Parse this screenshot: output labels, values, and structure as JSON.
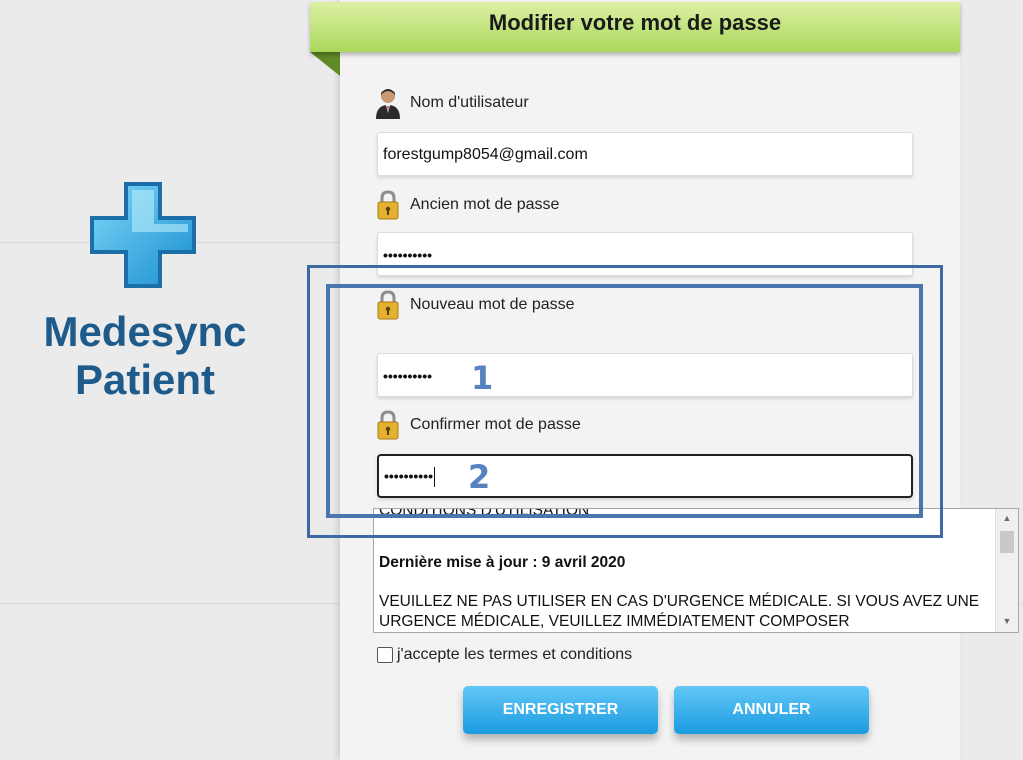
{
  "brand": {
    "line1": "Medesync",
    "line2": "Patient"
  },
  "header": {
    "title": "Modifier votre mot de passe"
  },
  "form": {
    "username_label": "Nom d'utilisateur",
    "username_value": "forestgump8054@gmail.com",
    "old_password_label": "Ancien mot de passe",
    "old_password_value": "••••••••••",
    "new_password_label": "Nouveau mot de passe",
    "new_password_value": "••••••••••",
    "confirm_password_label": "Confirmer mot de passe",
    "confirm_password_value": "••••••••••"
  },
  "annotations": {
    "step1": "1",
    "step2": "2"
  },
  "terms": {
    "heading": "CONDITIONS D'UTILISATION",
    "updated": "Dernière mise à jour : 9 avril 2020",
    "paragraph": "VEUILLEZ NE PAS UTILISER EN CAS D'URGENCE MÉDICALE. SI VOUS AVEZ UNE URGENCE MÉDICALE, VEUILLEZ IMMÉDIATEMENT COMPOSER"
  },
  "accept_label": "j'accepte les termes et conditions",
  "buttons": {
    "save": "ENREGISTRER",
    "cancel": "ANNULER"
  },
  "colors": {
    "brand": "#1e5b8a",
    "button": "#1b9be0",
    "header": "#a9d85a",
    "highlight": "#3d6aa3"
  },
  "icons": {
    "user": "user-avatar-icon",
    "lock": "padlock-icon"
  }
}
